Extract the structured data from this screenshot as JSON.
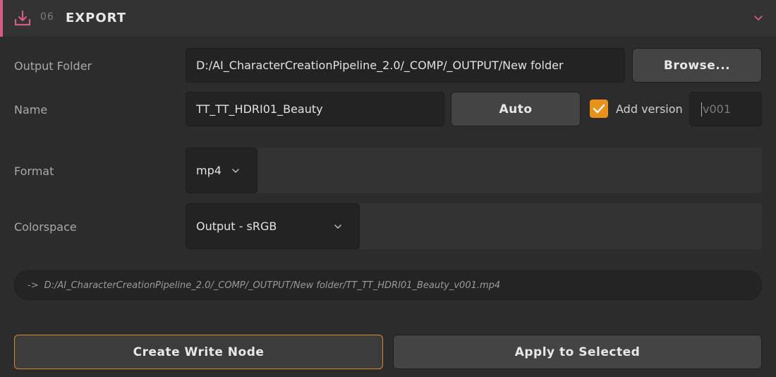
{
  "header": {
    "number": "06",
    "title": "EXPORT",
    "icon": "download-icon",
    "collapse_icon": "chevron-down-icon",
    "accent_color": "#d65b86"
  },
  "output_folder": {
    "label": "Output Folder",
    "value": "D:/AI_CharacterCreationPipeline_2.0/_COMP/_OUTPUT/New folder",
    "browse_label": "Browse..."
  },
  "name": {
    "label": "Name",
    "value": "TT_TT_HDRI01_Beauty",
    "auto_label": "Auto",
    "add_version_label": "Add version",
    "add_version_checked": true,
    "version_value": "v001",
    "checkbox_color": "#e8921c"
  },
  "format": {
    "label": "Format",
    "selected": "mp4"
  },
  "colorspace": {
    "label": "Colorspace",
    "selected": "Output - sRGB"
  },
  "preview": {
    "arrow": "->",
    "path": "D:/AI_CharacterCreationPipeline_2.0/_COMP/_OUTPUT/New folder/TT_TT_HDRI01_Beauty_v001.mp4"
  },
  "actions": {
    "create_label": "Create Write Node",
    "apply_label": "Apply to Selected",
    "create_border_color": "#d88a2a"
  }
}
